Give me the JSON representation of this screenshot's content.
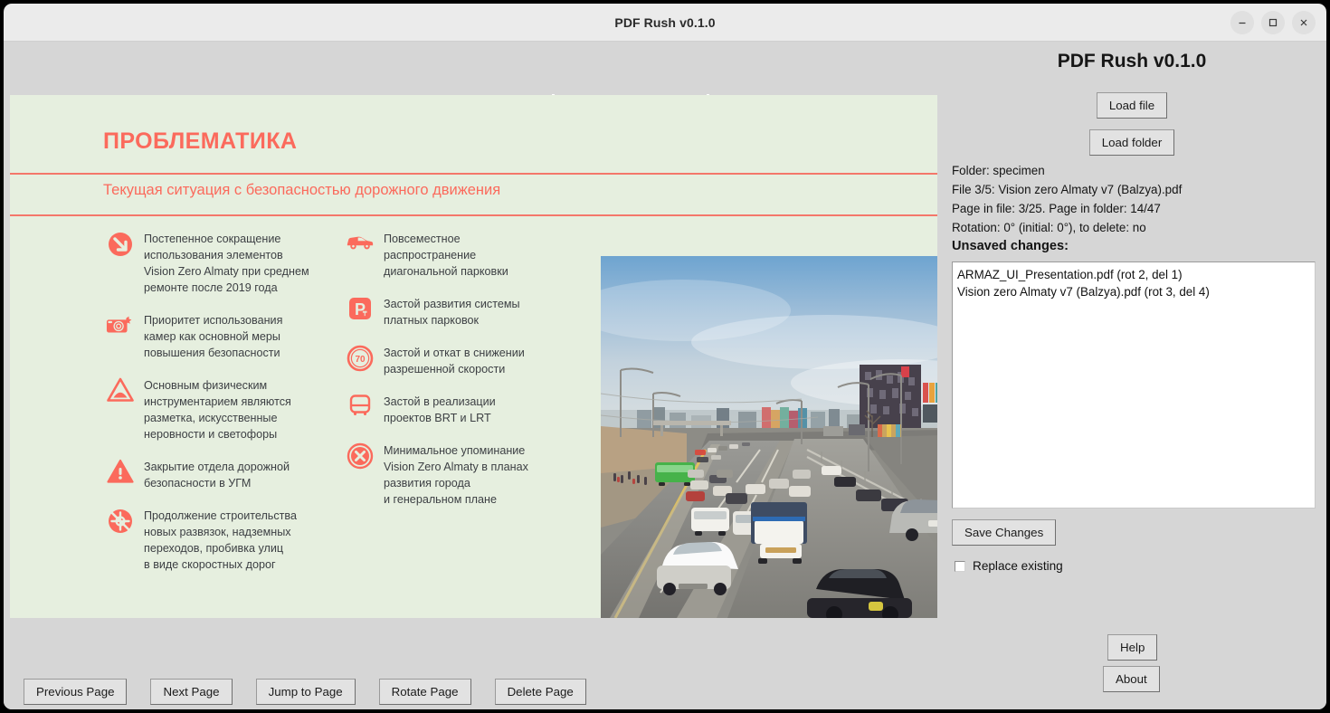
{
  "window": {
    "title": "PDF Rush v0.1.0",
    "controls": [
      {
        "name": "minimize-button",
        "glyph": "minimize"
      },
      {
        "name": "maximize-button",
        "glyph": "maximize"
      },
      {
        "name": "close-button",
        "glyph": "close"
      }
    ]
  },
  "panel": {
    "title": "PDF Rush v0.1.0",
    "load_file_label": "Load file",
    "load_folder_label": "Load folder",
    "info": {
      "folder": "Folder: specimen",
      "file": "File 3/5: Vision zero Almaty v7 (Balzya).pdf",
      "page": "Page in file: 3/25. Page in folder: 14/47",
      "rotation": "Rotation: 0° (initial: 0°), to delete: no",
      "unsaved_heading": "Unsaved changes:"
    },
    "unsaved_changes_text": "ARMAZ_UI_Presentation.pdf (rot 2, del 1)\nVision zero Almaty v7 (Balzya).pdf (rot 3, del 4)",
    "save_label": "Save Changes",
    "replace_existing_label": "Replace existing",
    "replace_existing_checked": false,
    "help_label": "Help",
    "about_label": "About"
  },
  "toolbar": {
    "previous_page": "Previous Page",
    "next_page": "Next Page",
    "jump_to_page": "Jump to Page",
    "rotate_page": "Rotate Page",
    "delete_page": "Delete Page"
  },
  "slide": {
    "title": "ПРОБЛЕМАТИКА",
    "subtitle": "Текущая ситуация с безопасностью дорожного движения",
    "accent_color": "#fb6a5c",
    "background_color": "#e6efdf",
    "left_bullets": [
      {
        "icon": "arrow-down-right-circle-icon",
        "text": "Постепенное сокращение\nиспользования элементов\nVision Zero Almaty при среднем\nремонте после 2019 года"
      },
      {
        "icon": "camera-flash-icon",
        "text": "Приоритет использования\nкамер как основной меры\nповышения безопасности"
      },
      {
        "icon": "speed-bump-sign-icon",
        "text": "Основным физическим\nинструментарием являются\nразметка, искусственные\nнеровности и светофоры"
      },
      {
        "icon": "warning-triangle-icon",
        "text": "Закрытие отдела дорожной\nбезопасности в УГМ"
      },
      {
        "icon": "no-interchange-circle-icon",
        "text": "Продолжение строительства\nновых развязок, надземных\nпереходов, пробивка улиц\nв виде скоростных дорог"
      }
    ],
    "right_bullets": [
      {
        "icon": "car-icon",
        "text": "Повсеместное\nраспространение\nдиагональной парковки"
      },
      {
        "icon": "paid-parking-sign-icon",
        "text": "Застой развития системы\nплатных парковок"
      },
      {
        "icon": "speed-limit-70-sign-icon",
        "text": "Застой и откат в снижении\nразрешенной скорости",
        "badge": "70"
      },
      {
        "icon": "bus-icon",
        "text": "Застой в реализации\nпроектов BRT и LRT"
      },
      {
        "icon": "cross-circle-icon",
        "text": "Минимальное упоминание\nVision Zero Almaty в планах\nразвития города\nи генеральном плане"
      }
    ],
    "photo_alt": "Highway traffic jam in Almaty with cars, vans, trucks and a green bus"
  }
}
